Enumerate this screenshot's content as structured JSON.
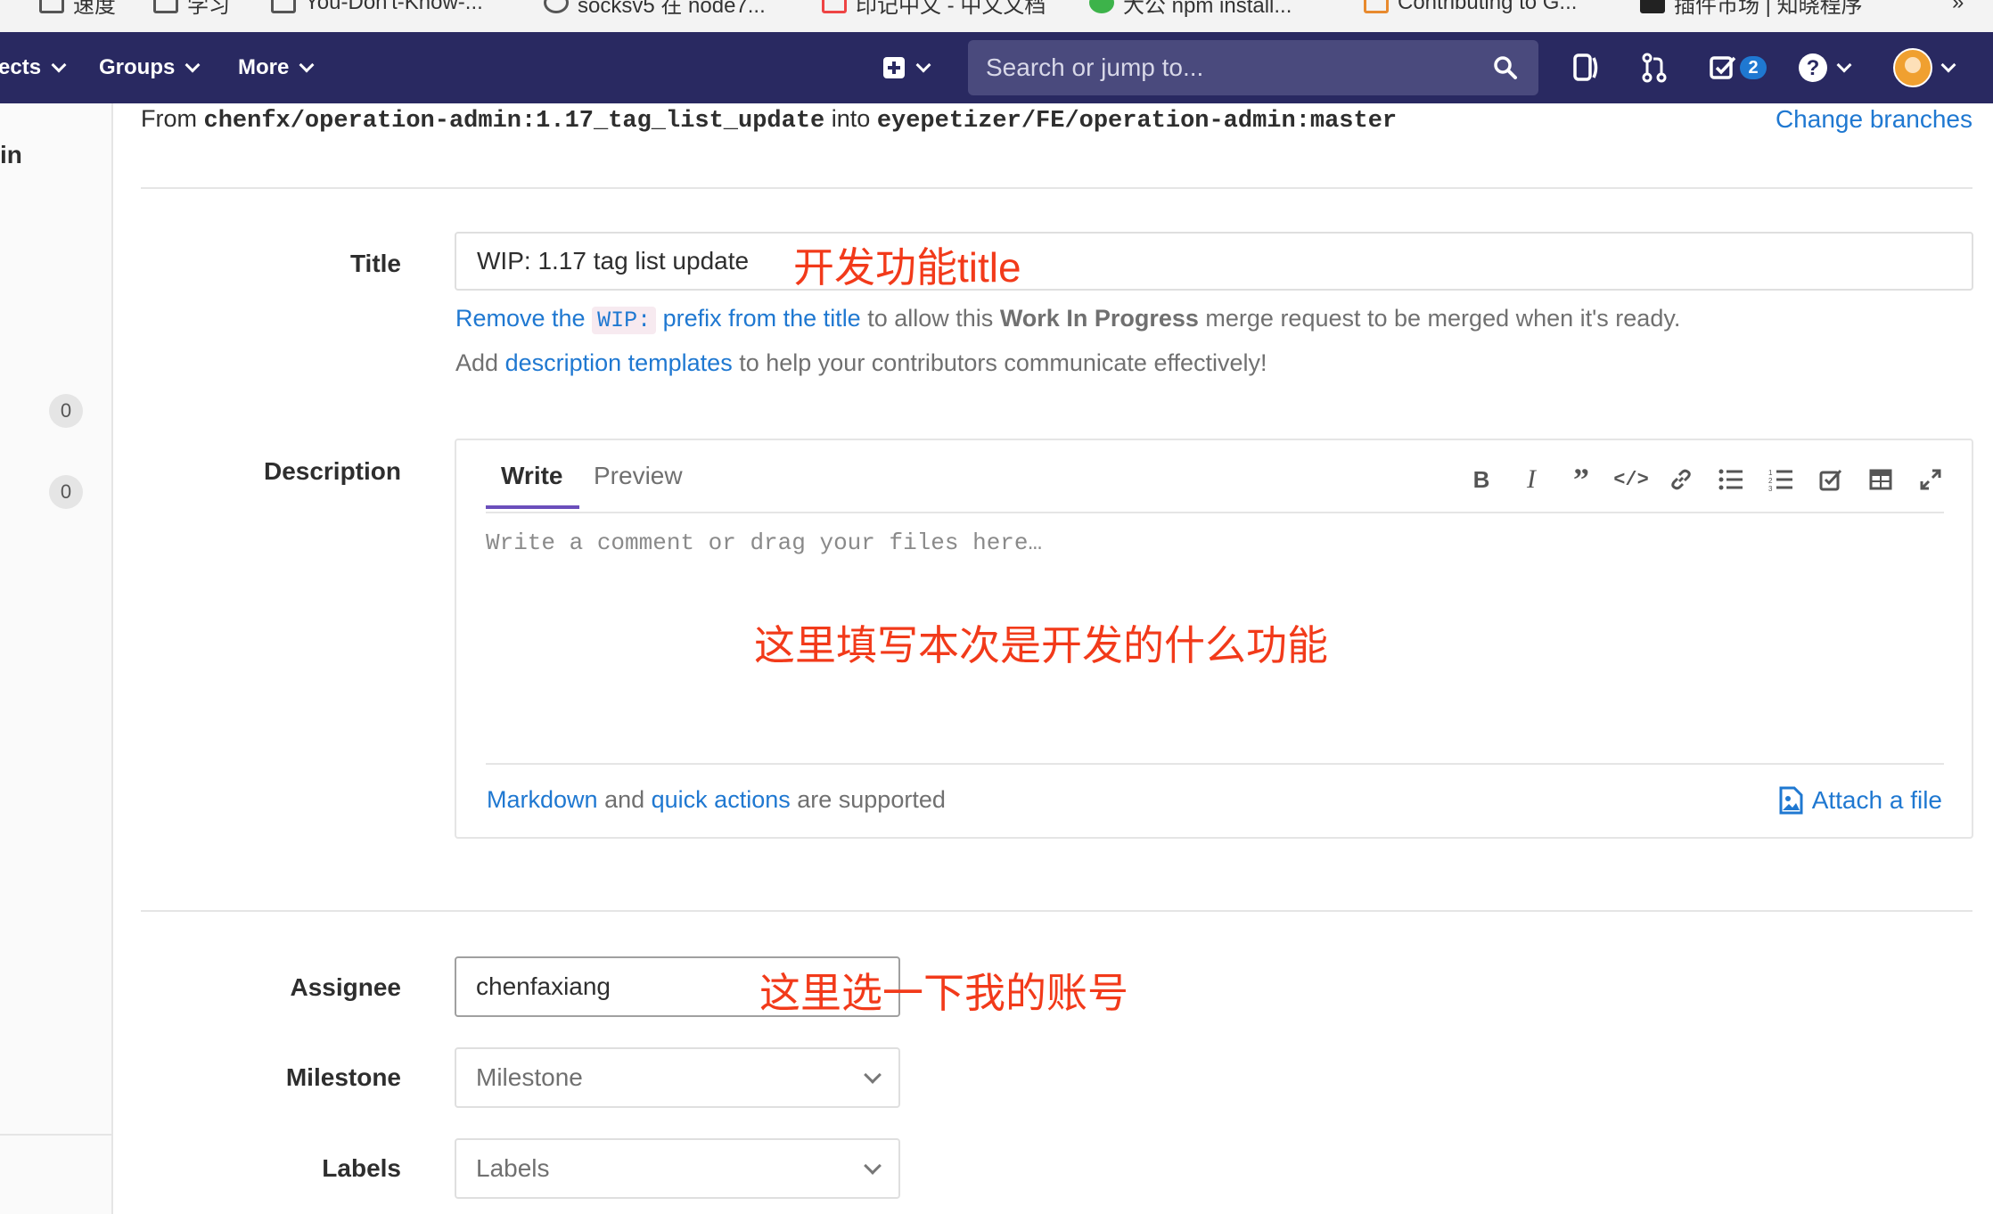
{
  "bookmarks": [
    {
      "label": "速度"
    },
    {
      "label": "学习"
    },
    {
      "label": "You-Don't-Know-..."
    },
    {
      "label": "socksv5 在 node7..."
    },
    {
      "label": "印记中文 - 中文文档"
    },
    {
      "label": "大公 npm install..."
    },
    {
      "label": "Contributing to G..."
    },
    {
      "label": "插件市场 | 知晓程序"
    }
  ],
  "navbar": {
    "projects_label": "ects",
    "groups_label": "Groups",
    "more_label": "More",
    "search_placeholder": "Search or jump to...",
    "todos_count": "2"
  },
  "sidebar": {
    "partial_label": "in",
    "counts": [
      "0",
      "0"
    ]
  },
  "merge": {
    "from_word": "From",
    "source_branch": "chenfx/operation-admin:1.17_tag_list_update",
    "into_word": "into",
    "target_branch": "eyepetizer/FE/operation-admin:master",
    "change_branches": "Change branches"
  },
  "form": {
    "title_label": "Title",
    "title_value": "WIP: 1.17 tag list update",
    "wip_hint": {
      "link1": "Remove the",
      "code": "WIP:",
      "link2": "prefix from the title",
      "text1": "to allow this",
      "bold": "Work In Progress",
      "text2": "merge request to be merged when it's ready."
    },
    "templates_hint": {
      "text1": "Add",
      "link": "description templates",
      "text2": "to help your contributors communicate effectively!"
    },
    "description_label": "Description",
    "tab_write": "Write",
    "tab_preview": "Preview",
    "description_placeholder": "Write a comment or drag your files here…",
    "footer": {
      "link1": "Markdown",
      "text1": "and",
      "link2": "quick actions",
      "text2": "are supported",
      "attach": "Attach a file"
    },
    "assignee_label": "Assignee",
    "assignee_value": "chenfaxiang",
    "milestone_label": "Milestone",
    "milestone_value": "Milestone",
    "labels_label": "Labels",
    "labels_value": "Labels"
  },
  "annotations": {
    "title_note": "开发功能title",
    "description_note": "这里填写本次是开发的什么功能",
    "assignee_note": "这里选一下我的账号"
  },
  "toolbar_icons": [
    "bold-icon",
    "italic-icon",
    "quote-icon",
    "code-icon",
    "link-icon",
    "bullet-list-icon",
    "numbered-list-icon",
    "task-list-icon",
    "table-icon",
    "fullscreen-icon"
  ],
  "colors": {
    "navbar": "#292961",
    "link": "#1f78d1",
    "annotation": "#f23a1a",
    "tab_active": "#6b4fbb"
  }
}
